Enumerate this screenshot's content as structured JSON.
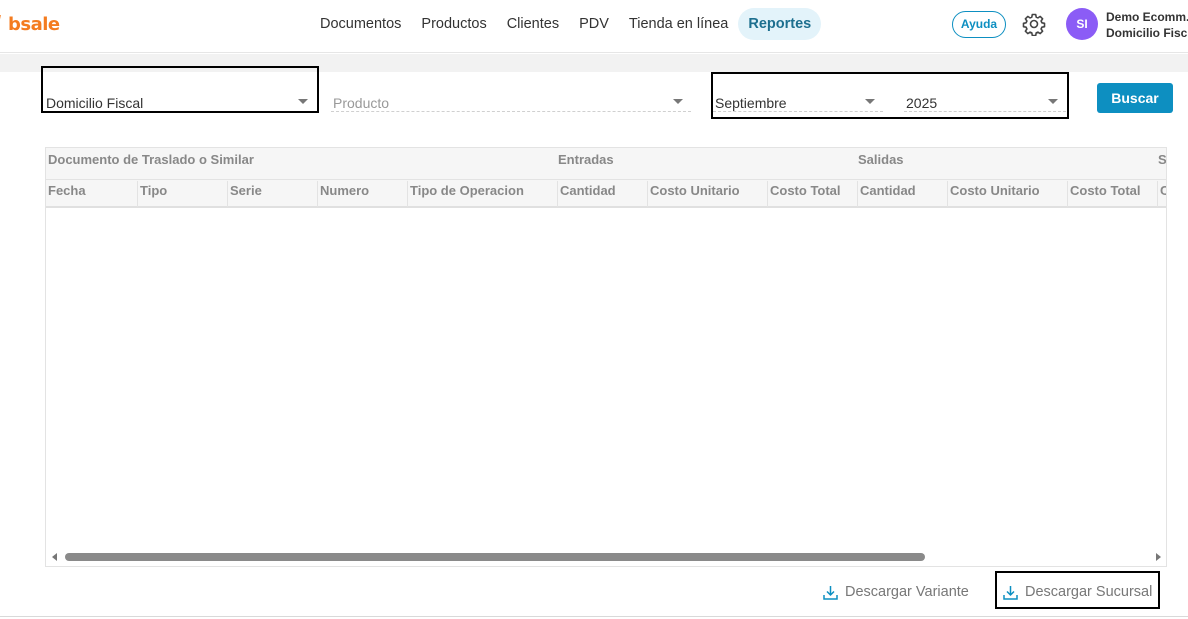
{
  "brand": {
    "name": "bsale",
    "color": "#f47c20"
  },
  "nav": {
    "items": [
      {
        "label": "Documentos"
      },
      {
        "label": "Productos"
      },
      {
        "label": "Clientes"
      },
      {
        "label": "PDV"
      },
      {
        "label": "Tienda en línea"
      },
      {
        "label": "Reportes",
        "active": true
      }
    ]
  },
  "header": {
    "help_label": "Ayuda",
    "settings_icon": "gear-icon",
    "avatar_initials": "SI",
    "avatar_color": "#8b5cf6",
    "user_name": "Demo Ecomm.",
    "user_branch": "Domicilio Fisc"
  },
  "filters": {
    "branch": "Domicilio Fiscal",
    "product_placeholder": "Producto",
    "month": "Septiembre",
    "year": "2025",
    "search_label": "Buscar"
  },
  "table": {
    "groups": [
      "Documento de Traslado o Similar",
      "Entradas",
      "Salidas",
      "S"
    ],
    "columns": [
      "Fecha",
      "Tipo",
      "Serie",
      "Numero",
      "Tipo de Operacion",
      "Cantidad",
      "Costo Unitario",
      "Costo Total",
      "Cantidad",
      "Costo Unitario",
      "Costo Total",
      "C"
    ],
    "rows": []
  },
  "downloads": {
    "variant_label": "Descargar Variante",
    "branch_label": "Descargar Sucursal",
    "icon": "download-icon"
  },
  "colors": {
    "accent": "#0d8fc1",
    "active_nav_bg": "#e3f3fa"
  }
}
